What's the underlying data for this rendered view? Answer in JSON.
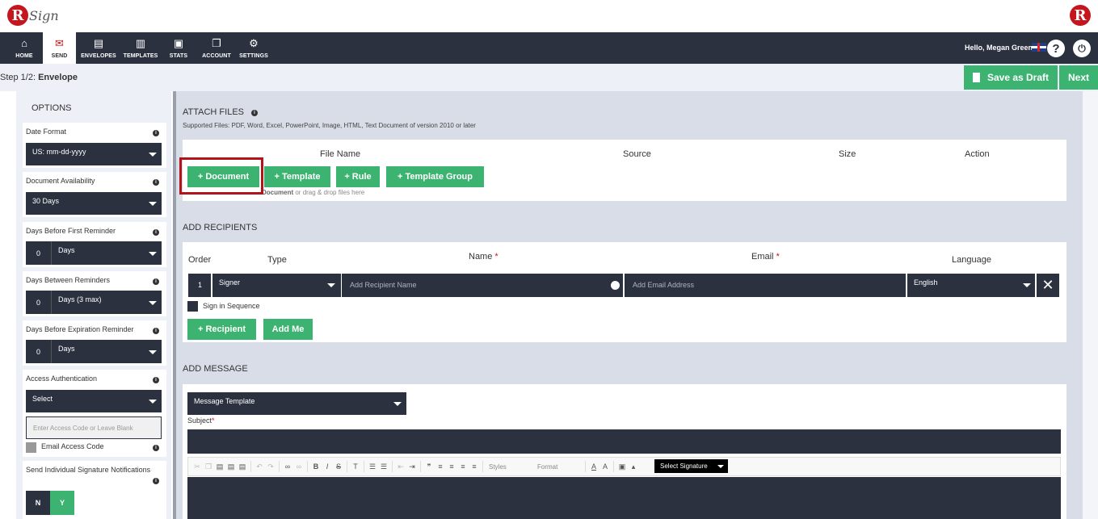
{
  "brand": {
    "logo_letter": "R",
    "logo_text": "Sign"
  },
  "nav": {
    "items": [
      {
        "label": "HOME",
        "icon": "home-icon",
        "glyph": "⌂"
      },
      {
        "label": "SEND",
        "icon": "envelope-icon",
        "glyph": "✉"
      },
      {
        "label": "ENVELOPES",
        "icon": "inbox-icon",
        "glyph": "▤"
      },
      {
        "label": "TEMPLATES",
        "icon": "templates-icon",
        "glyph": "▥"
      },
      {
        "label": "STATS",
        "icon": "briefcase-icon",
        "glyph": "▣"
      },
      {
        "label": "ACCOUNT",
        "icon": "account-icon",
        "glyph": "❐"
      },
      {
        "label": "SETTINGS",
        "icon": "gear-icon",
        "glyph": "⚙"
      }
    ],
    "greeting": "Hello, Megan Greene",
    "help_glyph": "?",
    "power_glyph": "⏻"
  },
  "step": {
    "prefix": "Step 1/2: ",
    "name": "Envelope"
  },
  "actions": {
    "save_draft": "Save as Draft",
    "next": "Next"
  },
  "options": {
    "title": "OPTIONS",
    "date_format": {
      "label": "Date Format",
      "value": "US: mm-dd-yyyy"
    },
    "doc_availability": {
      "label": "Document Availability",
      "value": "30 Days"
    },
    "first_reminder": {
      "label": "Days Before First Reminder",
      "num": "0",
      "unit": "Days"
    },
    "between_reminders": {
      "label": "Days Between Reminders",
      "num": "0",
      "unit": "Days (3 max)"
    },
    "expiration_reminder": {
      "label": "Days Before Expiration Reminder",
      "num": "0",
      "unit": "Days"
    },
    "access_auth": {
      "label": "Access Authentication",
      "value": "Select",
      "placeholder": "Enter Access Code or Leave Blank",
      "email_code": "Email Access Code"
    },
    "individual_notifications": {
      "label": "Send Individual Signature Notifications",
      "no": "N",
      "yes": "Y"
    }
  },
  "attach": {
    "title": "ATTACH FILES",
    "supported": "Supported Files: PDF, Word, Excel, PowerPoint, Image, HTML, Text Document of version 2010 or later",
    "columns": [
      "File Name",
      "Source",
      "Size",
      "Action"
    ],
    "buttons": [
      "+ Document",
      "+ Template",
      "+ Rule",
      "+ Template Group"
    ],
    "drop_hint_bold": "Document",
    "drop_hint": "or drag & drop files here"
  },
  "recipients": {
    "title": "ADD RECIPIENTS",
    "columns": {
      "order": "Order",
      "type": "Type",
      "name": "Name",
      "email": "Email",
      "language": "Language",
      "required": "*"
    },
    "row": {
      "order": "1",
      "type": "Signer",
      "name_placeholder": "Add Recipient Name",
      "email_placeholder": "Add Email Address",
      "language": "English"
    },
    "sign_in_sequence": "Sign in Sequence",
    "add_recipient": "+ Recipient",
    "add_me": "Add Me"
  },
  "message": {
    "title": "ADD MESSAGE",
    "template_select": "Message Template",
    "subject_label": "Subject",
    "styles": "Styles",
    "format": "Format",
    "select_signature": "Select Signature"
  },
  "colors": {
    "nav": "#2c3140",
    "accent": "#3cb371",
    "brand": "#c4161c"
  }
}
